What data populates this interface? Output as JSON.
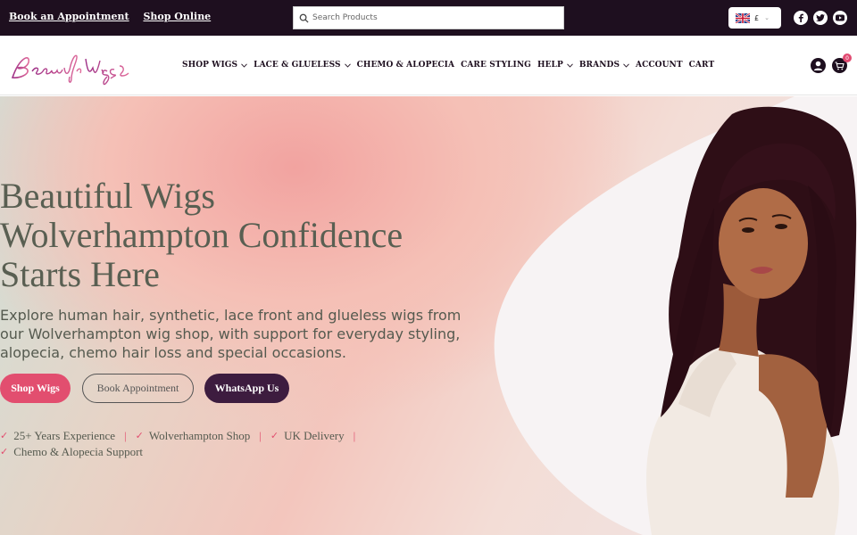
{
  "topbar": {
    "book_link": "Book an Appointment",
    "shop_link": "Shop Online",
    "search_placeholder": "Search Products",
    "currency": "£",
    "social": [
      "facebook-icon",
      "twitter-icon",
      "youtube-icon"
    ]
  },
  "nav": {
    "logo_text": "Beautiful Wigs",
    "items": [
      {
        "label": "SHOP WIGS",
        "dropdown": true
      },
      {
        "label": "LACE & GLUELESS",
        "dropdown": true
      },
      {
        "label": "CHEMO & ALOPECIA",
        "dropdown": false
      },
      {
        "label": "CARE STYLING",
        "dropdown": false
      },
      {
        "label": "HELP",
        "dropdown": true
      },
      {
        "label": "BRANDS",
        "dropdown": true
      },
      {
        "label": "ACCOUNT",
        "dropdown": false
      },
      {
        "label": "CART",
        "dropdown": false
      }
    ],
    "cart_count": "0"
  },
  "hero": {
    "title_line1": "Beautiful Wigs",
    "title_line2": "Wolverhampton Confidence",
    "title_line3": "Starts Here",
    "subtitle": "Explore human hair, synthetic, lace front and glueless wigs from our Wolverhampton wig shop, with support for everyday styling, alopecia, chemo hair loss and special occasions.",
    "buttons": {
      "shop": "Shop Wigs",
      "book": "Book Appointment",
      "whatsapp": "WhatsApp Us"
    },
    "features": [
      "25+ Years Experience",
      "Wolverhampton Shop",
      "UK Delivery",
      "Chemo & Alopecia Support"
    ]
  },
  "colors": {
    "dark": "#1e0f1f",
    "accent_pink": "#e24e6f",
    "accent_purple": "#3d1c3f",
    "heading": "#595f52"
  }
}
